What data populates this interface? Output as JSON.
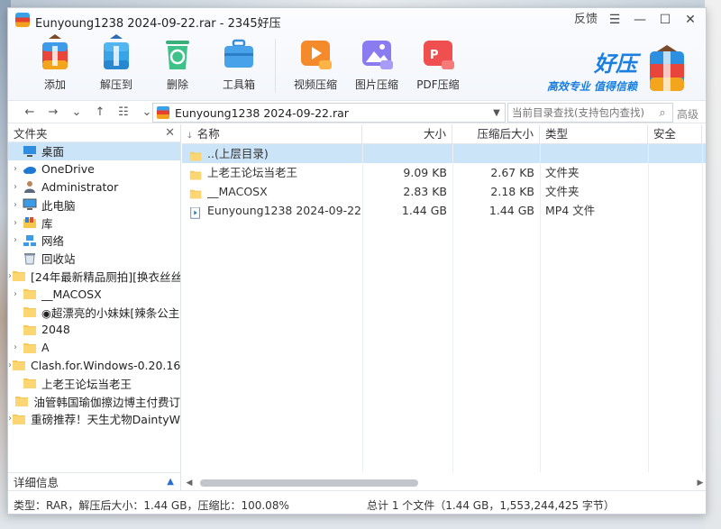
{
  "window": {
    "title": "Eunyoung1238 2024-09-22.rar - 2345好压",
    "controls": {
      "feedback": "反馈",
      "menu": "☰",
      "minimize": "—",
      "maximize": "☐",
      "close": "✕"
    }
  },
  "toolbar": {
    "add": "添加",
    "extract": "解压到",
    "delete": "删除",
    "toolbox": "工具箱",
    "video": "视频压缩",
    "image": "图片压缩",
    "pdf": "PDF压缩"
  },
  "brand": {
    "name": "好压",
    "slogan": "高效专业 值得信赖"
  },
  "address": {
    "path": "Eunyoung1238 2024-09-22.rar",
    "search_placeholder": "当前目录查找(支持包内查找)",
    "advanced": "高级"
  },
  "folders_panel": {
    "title": "文件夹",
    "items": [
      {
        "label": "桌面",
        "icon": "desktop-icon",
        "arrow": "",
        "selected": true
      },
      {
        "label": "OneDrive",
        "icon": "cloud-icon",
        "arrow": "›"
      },
      {
        "label": "Administrator",
        "icon": "user-icon",
        "arrow": "›"
      },
      {
        "label": "此电脑",
        "icon": "computer-icon",
        "arrow": "›"
      },
      {
        "label": "库",
        "icon": "library-icon",
        "arrow": "›"
      },
      {
        "label": "网络",
        "icon": "network-icon",
        "arrow": "›"
      },
      {
        "label": "回收站",
        "icon": "recycle-bin-icon",
        "arrow": ""
      },
      {
        "label": "[24年最新精品厕拍][换衣丝丝",
        "icon": "folder-icon",
        "arrow": "›"
      },
      {
        "label": "__MACOSX",
        "icon": "folder-icon",
        "arrow": "›"
      },
      {
        "label": "◉超漂亮的小妹妹[辣条公主",
        "icon": "folder-icon",
        "arrow": ""
      },
      {
        "label": "2048",
        "icon": "folder-icon",
        "arrow": ""
      },
      {
        "label": "A",
        "icon": "folder-icon",
        "arrow": "›"
      },
      {
        "label": "Clash.for.Windows-0.20.16",
        "icon": "folder-icon",
        "arrow": "›"
      },
      {
        "label": "上老王论坛当老王",
        "icon": "folder-icon",
        "arrow": ""
      },
      {
        "label": "油管韩国瑜伽擦边博主付费订",
        "icon": "folder-icon",
        "arrow": ""
      },
      {
        "label": "重磅推荐！天生尤物DaintyW",
        "icon": "folder-icon",
        "arrow": "›"
      }
    ],
    "details": "详细信息"
  },
  "list": {
    "columns": {
      "name": "名称",
      "size": "大小",
      "packed": "压缩后大小",
      "type": "类型",
      "security": "安全"
    },
    "rows": [
      {
        "name": "..(上层目录)",
        "size": "",
        "packed": "",
        "type": "",
        "icon": "folder-icon",
        "selected": true
      },
      {
        "name": "上老王论坛当老王",
        "size": "9.09 KB",
        "packed": "2.67 KB",
        "type": "文件夹",
        "icon": "folder-icon"
      },
      {
        "name": "__MACOSX",
        "size": "2.83 KB",
        "packed": "2.18 KB",
        "type": "文件夹",
        "icon": "folder-icon"
      },
      {
        "name": "Eunyoung1238 2024-09-22....",
        "size": "1.44 GB",
        "packed": "1.44 GB",
        "type": "MP4 文件",
        "icon": "video-file-icon"
      }
    ]
  },
  "status": {
    "left": "类型：RAR，解压后大小：1.44 GB，压缩比：100.08%",
    "right": "总计 1 个文件（1.44 GB，1,553,244,425 字节）"
  }
}
